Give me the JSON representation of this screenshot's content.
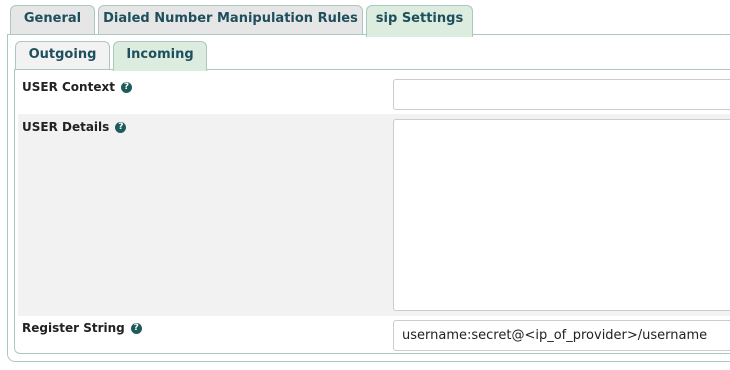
{
  "outer_tabs": [
    {
      "label": "General",
      "active": false
    },
    {
      "label": "Dialed Number Manipulation Rules",
      "active": false
    },
    {
      "label": "sip Settings",
      "active": true
    }
  ],
  "inner_tabs": [
    {
      "label": "Outgoing",
      "active": false
    },
    {
      "label": "Incoming",
      "active": true
    }
  ],
  "form": {
    "user_context": {
      "label": "USER Context",
      "value": ""
    },
    "user_details": {
      "label": "USER Details",
      "value": ""
    },
    "register_string": {
      "label": "Register String",
      "value": "username:secret@<ip_of_provider>/username"
    }
  },
  "help_glyph": "?"
}
